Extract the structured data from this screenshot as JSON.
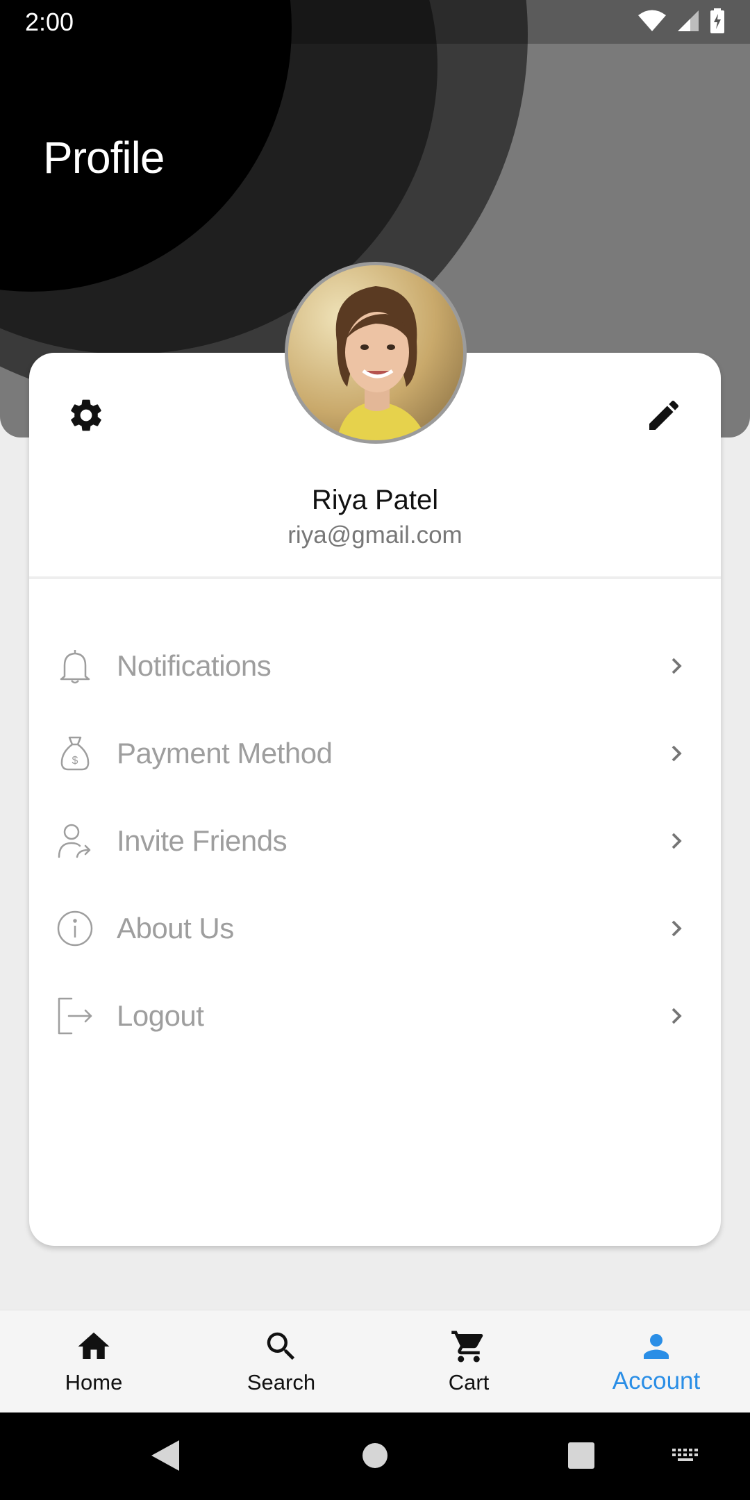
{
  "status_bar": {
    "time": "2:00"
  },
  "header": {
    "title": "Profile"
  },
  "profile": {
    "name": "Riya Patel",
    "email": "riya@gmail.com"
  },
  "menu": [
    {
      "label": "Notifications",
      "icon": "bell-icon"
    },
    {
      "label": "Payment Method",
      "icon": "money-bag-icon"
    },
    {
      "label": "Invite Friends",
      "icon": "invite-user-icon"
    },
    {
      "label": "About Us",
      "icon": "info-icon"
    },
    {
      "label": "Logout",
      "icon": "logout-icon"
    }
  ],
  "bottom_nav": [
    {
      "label": "Home",
      "icon": "home-icon",
      "active": false
    },
    {
      "label": "Search",
      "icon": "search-icon",
      "active": false
    },
    {
      "label": "Cart",
      "icon": "cart-icon",
      "active": false
    },
    {
      "label": "Account",
      "icon": "account-icon",
      "active": true
    }
  ],
  "colors": {
    "accent": "#2a8ee6",
    "menu_text": "#9e9e9e",
    "header_bg": "#7a7a7a"
  }
}
